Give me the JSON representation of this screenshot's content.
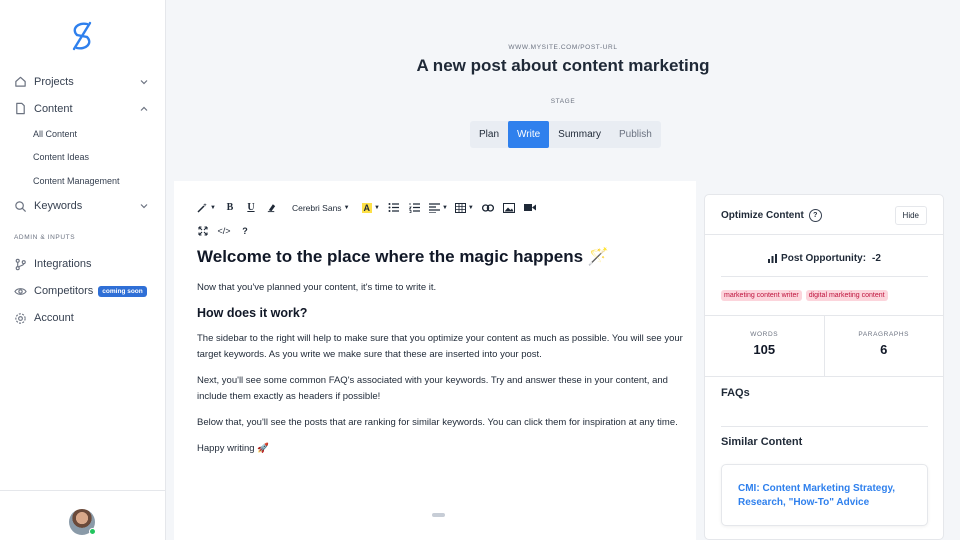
{
  "app": {
    "brand": "S"
  },
  "sidebar": {
    "items": [
      {
        "label": "Projects",
        "icon": "home-icon"
      },
      {
        "label": "Content",
        "icon": "document-icon"
      },
      {
        "label": "Keywords",
        "icon": "search-icon"
      }
    ],
    "content_sub": [
      "All Content",
      "Content Ideas",
      "Content Management"
    ],
    "admin_label": "ADMIN & INPUTS",
    "admin_items": [
      {
        "label": "Integrations",
        "icon": "integrations-icon"
      },
      {
        "label": "Competitors",
        "icon": "eye-icon",
        "badge": "coming soon"
      },
      {
        "label": "Account",
        "icon": "gear-icon"
      }
    ]
  },
  "header": {
    "post_url": "WWW.MYSITE.COM/POST-URL",
    "title": "A new post about content marketing",
    "stage_label": "STAGE",
    "stages": [
      "Plan",
      "Write",
      "Summary",
      "Publish"
    ],
    "active_stage": "Write"
  },
  "toolbar": {
    "font": "Cerebri Sans",
    "bold": "B",
    "underline": "U",
    "highlight": "A",
    "code": "</>",
    "help": "?"
  },
  "editor": {
    "h1": "Welcome to the place where the magic happens 🪄",
    "p1": "Now that you've planned your content, it's time to write it.",
    "h2": "How does it work?",
    "p2": "The sidebar to the right will help to make sure that you optimize your content as much as possible. You will see your target keywords. As you write we make sure that these are inserted into your post.",
    "p3": "Next, you'll see some common FAQ's associated with your keywords. Try and answer these in your content, and include them exactly as headers if possible!",
    "p4": "Below that, you'll see the posts that are ranking for similar keywords. You can click them for inspiration at any time.",
    "p5": "Happy writing 🚀"
  },
  "panel": {
    "title": "Optimize Content",
    "help": "?",
    "hide_label": "Hide",
    "opportunity_label": "Post Opportunity:",
    "opportunity_value": "-2",
    "keywords": [
      "marketing content writer",
      "digital marketing content"
    ],
    "words_label": "WORDS",
    "words_value": "105",
    "paragraphs_label": "PARAGRAPHS",
    "paragraphs_value": "6",
    "faqs_heading": "FAQs",
    "similar_heading": "Similar Content",
    "similar_items": [
      "CMI: Content Marketing Strategy, Research, \"How-To\" Advice"
    ]
  },
  "colors": {
    "accent": "#2f80ed",
    "keyword_bg": "#fcd5dc",
    "keyword_text": "#be123c",
    "highlight": "#fde047"
  }
}
